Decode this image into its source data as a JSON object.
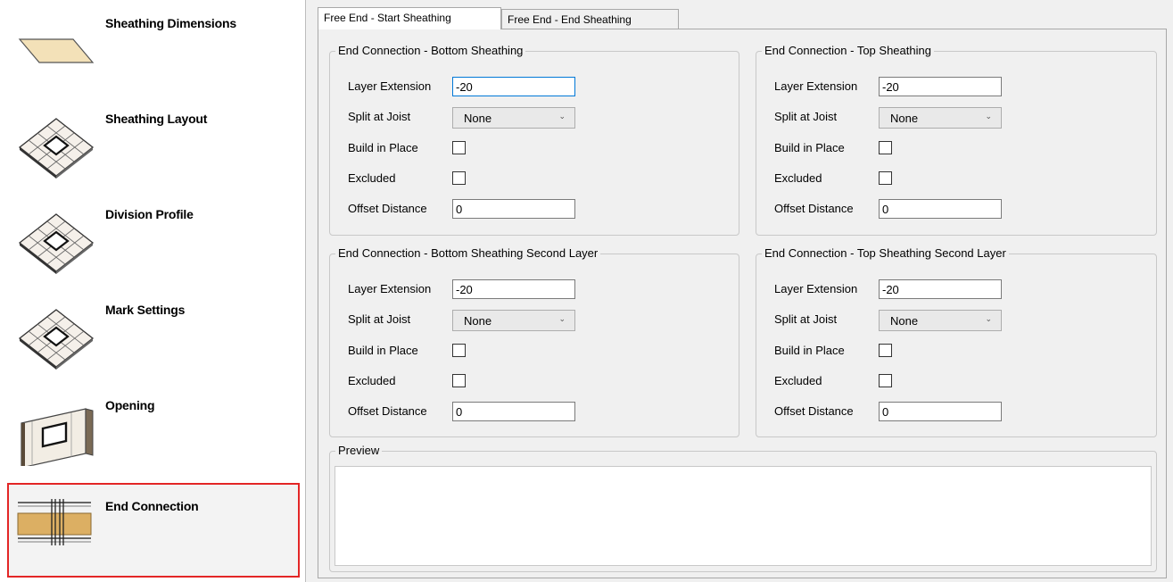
{
  "sidebar": {
    "items": [
      {
        "label": "Sheathing Dimensions",
        "icon": "parallelogram-board-icon"
      },
      {
        "label": "Sheathing Layout",
        "icon": "sheathing-grid-icon"
      },
      {
        "label": "Division Profile",
        "icon": "sheathing-grid-icon"
      },
      {
        "label": "Mark Settings",
        "icon": "sheathing-grid-icon"
      },
      {
        "label": "Opening",
        "icon": "wall-opening-icon"
      },
      {
        "label": "End Connection",
        "icon": "end-connection-icon",
        "selected": true
      }
    ]
  },
  "tabs": [
    {
      "label": "Free End - Start Sheathing",
      "active": true
    },
    {
      "label": "Free End - End Sheathing",
      "active": false
    }
  ],
  "groups": [
    {
      "title": "End Connection - Bottom Sheathing",
      "layer_extension_label": "Layer Extension",
      "layer_extension": "-20",
      "split_label": "Split at Joist",
      "split": "None",
      "build_label": "Build in Place",
      "excluded_label": "Excluded",
      "offset_label": "Offset Distance",
      "offset": "0"
    },
    {
      "title": "End Connection - Top Sheathing",
      "layer_extension_label": "Layer Extension",
      "layer_extension": "-20",
      "split_label": "Split at Joist",
      "split": "None",
      "build_label": "Build in Place",
      "excluded_label": "Excluded",
      "offset_label": "Offset Distance",
      "offset": "0"
    },
    {
      "title": "End Connection - Bottom Sheathing Second Layer",
      "layer_extension_label": "Layer Extension",
      "layer_extension": "-20",
      "split_label": "Split at Joist",
      "split": "None",
      "build_label": "Build in Place",
      "excluded_label": "Excluded",
      "offset_label": "Offset Distance",
      "offset": "0"
    },
    {
      "title": "End Connection -  Top Sheathing Second Layer",
      "layer_extension_label": "Layer Extension",
      "layer_extension": "-20",
      "split_label": "Split at Joist",
      "split": "None",
      "build_label": "Build in Place",
      "excluded_label": "Excluded",
      "offset_label": "Offset Distance",
      "offset": "0"
    }
  ],
  "preview": {
    "title": "Preview"
  },
  "colors": {
    "selection_border": "#e32626",
    "focus_border": "#0078d7",
    "board_fill": "#f3e1b8"
  }
}
